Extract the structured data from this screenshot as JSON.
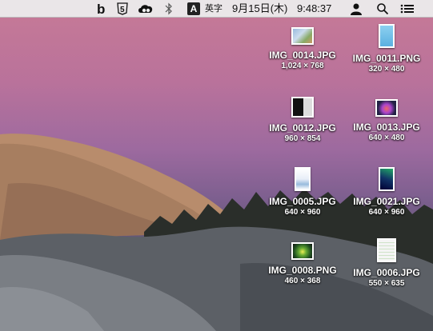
{
  "menubar": {
    "input_source_letter": "A",
    "input_mode": "英字",
    "date": "9月15日(木)",
    "time": "9:48:37",
    "status_icons": [
      "b-app-icon",
      "five-app-icon",
      "creative-cloud-icon",
      "bluetooth-icon",
      "input-source-icon",
      "user-icon",
      "spotlight-search-icon",
      "notification-center-icon"
    ]
  },
  "desktop": {
    "files": [
      {
        "name": "IMG_0014.JPG",
        "dims": "1,024 × 768"
      },
      {
        "name": "IMG_0011.PNG",
        "dims": "320 × 480"
      },
      {
        "name": "IMG_0012.JPG",
        "dims": "960 × 854"
      },
      {
        "name": "IMG_0013.JPG",
        "dims": "640 × 480"
      },
      {
        "name": "IMG_0005.JPG",
        "dims": "640 × 960"
      },
      {
        "name": "IMG_0021.JPG",
        "dims": "640 × 960"
      },
      {
        "name": "IMG_0008.PNG",
        "dims": "460 × 368"
      },
      {
        "name": "IMG_0006.JPG",
        "dims": "550 × 635"
      }
    ]
  }
}
